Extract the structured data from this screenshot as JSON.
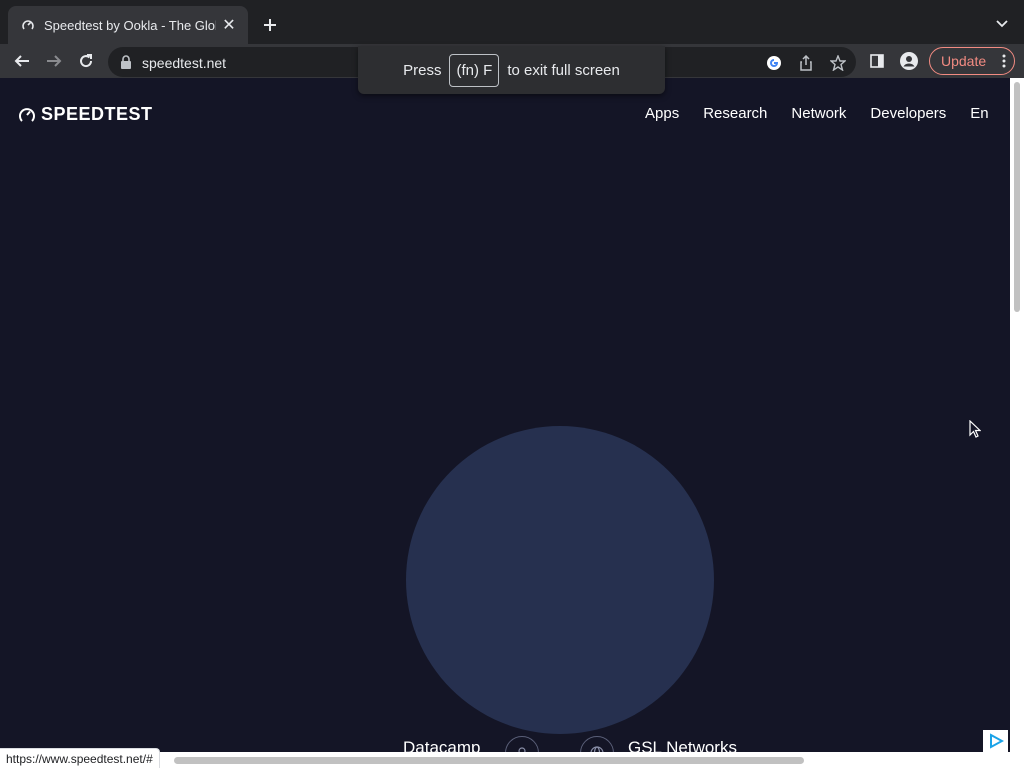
{
  "browser": {
    "tab_title": "Speedtest by Ookla - The Glob",
    "url": "speedtest.net",
    "update_label": "Update",
    "status_url": "https://www.speedtest.net/#"
  },
  "fullscreen_toast": {
    "press": "Press",
    "key": "(fn) F",
    "suffix": "to exit full screen"
  },
  "site": {
    "logo_text": "SPEEDTEST",
    "nav": [
      "Apps",
      "Research",
      "Network",
      "Developers",
      "En"
    ]
  },
  "test": {
    "provider": "Datacamp",
    "server": "GSL Networks"
  },
  "colors": {
    "page_bg": "#141526",
    "circle": "#26304f",
    "update_accent": "#f28b82"
  }
}
